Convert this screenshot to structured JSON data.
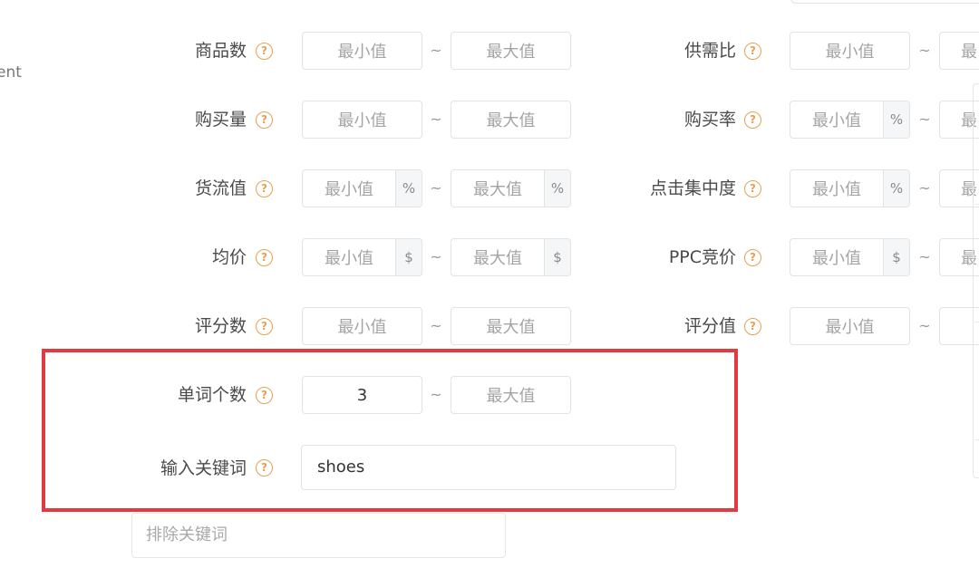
{
  "left_fragment": "ent",
  "help_glyph": "?",
  "range_separator": "~",
  "filters_left": [
    {
      "label": "商品数",
      "min": {
        "placeholder": "最小值",
        "unit": ""
      },
      "max": {
        "placeholder": "最大值",
        "unit": ""
      }
    },
    {
      "label": "购买量",
      "min": {
        "placeholder": "最小值",
        "unit": ""
      },
      "max": {
        "placeholder": "最大值",
        "unit": ""
      }
    },
    {
      "label": "货流值",
      "min": {
        "placeholder": "最小值",
        "unit": "%"
      },
      "max": {
        "placeholder": "最大值",
        "unit": "%"
      }
    },
    {
      "label": "均价",
      "min": {
        "placeholder": "最小值",
        "unit": "$"
      },
      "max": {
        "placeholder": "最大值",
        "unit": "$"
      }
    },
    {
      "label": "评分数",
      "min": {
        "placeholder": "最小值",
        "unit": ""
      },
      "max": {
        "placeholder": "最大值",
        "unit": ""
      }
    },
    {
      "label": "单词个数",
      "min": {
        "value": "3",
        "unit": ""
      },
      "max": {
        "placeholder": "最大值",
        "unit": ""
      }
    }
  ],
  "filters_right": [
    {
      "label": "供需比",
      "min": {
        "placeholder": "最小值",
        "unit": ""
      },
      "max_partial": "最"
    },
    {
      "label": "购买率",
      "min": {
        "placeholder": "最小值",
        "unit": "%"
      },
      "max_partial": "最"
    },
    {
      "label": "点击集中度",
      "min": {
        "placeholder": "最小值",
        "unit": "%"
      },
      "max_partial": "最"
    },
    {
      "label": "PPC竞价",
      "min": {
        "placeholder": "最小值",
        "unit": "$"
      },
      "max_partial": "最"
    },
    {
      "label": "评分值",
      "min": {
        "placeholder": "最小值",
        "unit": ""
      },
      "max_partial": ""
    }
  ],
  "keyword": {
    "label": "输入关键词",
    "value": "shoes"
  },
  "exclude_keyword": {
    "placeholder": "排除关键词"
  },
  "colors": {
    "highlight": "#e33a3f",
    "help_icon": "#e8a052"
  }
}
